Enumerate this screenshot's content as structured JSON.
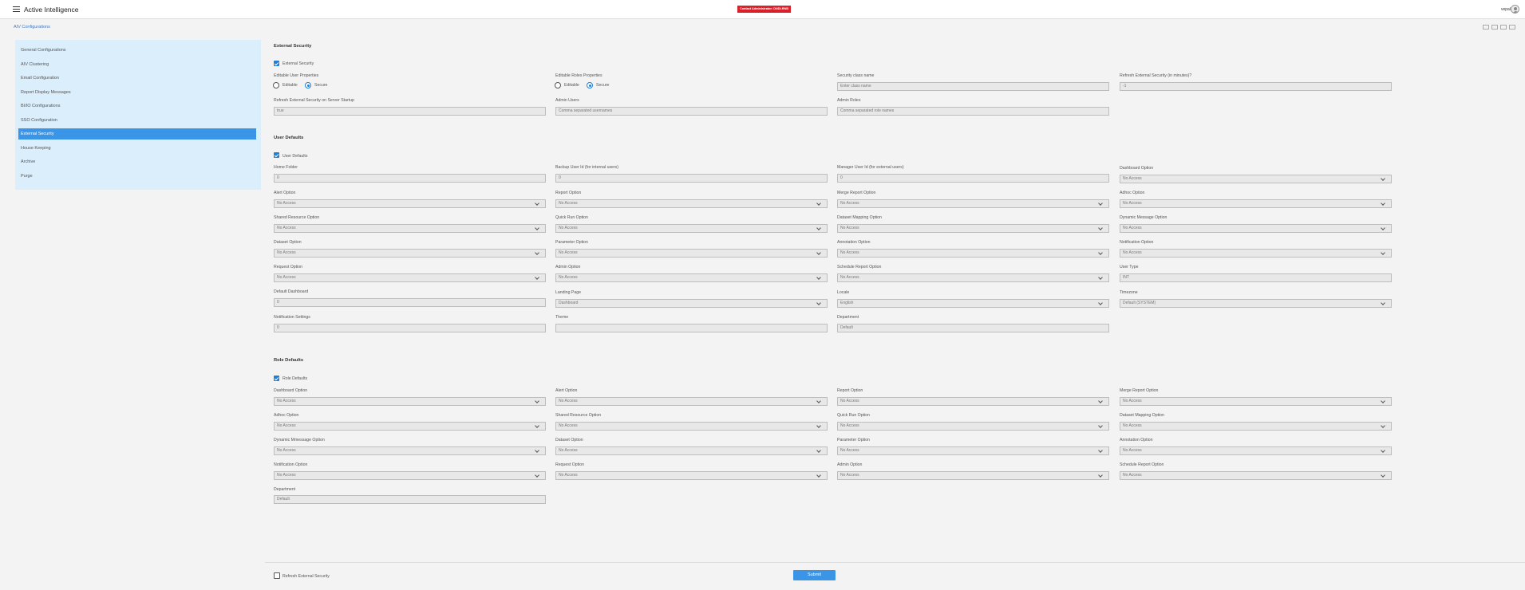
{
  "app": {
    "title": "Active Intelligence",
    "contact_badge": "Contact Administrator: DNDLRNB",
    "user": "vepal"
  },
  "breadcrumb": "AIV Configurations",
  "sidebar": {
    "items": [
      {
        "label": "General Configurations"
      },
      {
        "label": "AIV Clustering"
      },
      {
        "label": "Email Configuration"
      },
      {
        "label": "Report Display Messages"
      },
      {
        "label": "BI/IO Configurations"
      },
      {
        "label": "SSO Configuration"
      },
      {
        "label": "External Security"
      },
      {
        "label": "House Keeping"
      },
      {
        "label": "Archive"
      },
      {
        "label": "Purge"
      }
    ]
  },
  "external_security": {
    "title": "External Security",
    "checkbox": "External Security",
    "editable_user_properties": "Editable User Properties",
    "editable_roles_properties": "Editable Roles Properties",
    "editable": "Editable",
    "secure": "Secure",
    "security_class_name": {
      "label": "Security class name",
      "placeholder": "Enter class name"
    },
    "refresh_minutes": {
      "label": "Refresh External Security (in minutes)?",
      "value": "-1"
    },
    "refresh_startup": {
      "label": "Refresh External Security on Server Startup",
      "value": "true"
    },
    "admin_users": {
      "label": "Admin Users",
      "placeholder": "Comma separated usernames"
    },
    "admin_roles": {
      "label": "Admin Roles",
      "placeholder": "Comma separated role names"
    }
  },
  "user_defaults": {
    "title": "User Defaults",
    "checkbox": "User Defaults",
    "home_folder": {
      "label": "Home Folder",
      "value": "0"
    },
    "backup_user": {
      "label": "Backup User Id (for internal users)",
      "value": "0"
    },
    "manager_user": {
      "label": "Manager User Id (for external users)",
      "value": "0"
    },
    "dashboard_option": {
      "label": "Dashboard Option",
      "value": "No Access"
    },
    "alert_option": {
      "label": "Alert Option",
      "value": "No Access"
    },
    "report_option": {
      "label": "Report Option",
      "value": "No Access"
    },
    "merge_report_option": {
      "label": "Merge Report Option",
      "value": "No Access"
    },
    "adhoc_option": {
      "label": "Adhoc Option",
      "value": "No Access"
    },
    "shared_resource_option": {
      "label": "Shared Resource Option",
      "value": "No Access"
    },
    "quick_run_option": {
      "label": "Quick Run Option",
      "value": "No Access"
    },
    "dataset_mapping_option": {
      "label": "Dataset Mapping Option",
      "value": "No Access"
    },
    "dynamic_message_option": {
      "label": "Dynamic Message Option",
      "value": "No Access"
    },
    "dataset_option": {
      "label": "Dataset Option",
      "value": "No Access"
    },
    "parameter_option": {
      "label": "Parameter Option",
      "value": "No Access"
    },
    "annotation_option": {
      "label": "Annotation Option",
      "value": "No Access"
    },
    "notification_option": {
      "label": "Notification Option",
      "value": "No Access"
    },
    "request_option": {
      "label": "Request Option",
      "value": "No Access"
    },
    "admin_option": {
      "label": "Admin Option",
      "value": "No Access"
    },
    "schedule_report_option": {
      "label": "Schedule Report Option",
      "value": "No Access"
    },
    "user_type": {
      "label": "User Type",
      "value": "INT"
    },
    "default_dashboard": {
      "label": "Default Dashboard",
      "value": "0"
    },
    "landing_page": {
      "label": "Landing Page",
      "value": "Dashboard"
    },
    "locale": {
      "label": "Locale",
      "value": "English"
    },
    "timezone": {
      "label": "Timezone",
      "value": "Default (SYSTEM)"
    },
    "notification_settings": {
      "label": "Notification Settings",
      "value": "0"
    },
    "theme": {
      "label": "Theme",
      "value": ""
    },
    "department": {
      "label": "Department",
      "value": "Default"
    }
  },
  "role_defaults": {
    "title": "Role Defaults",
    "checkbox": "Role Defaults",
    "dashboard_option": {
      "label": "Dashboard Option",
      "value": "No Access"
    },
    "alert_option": {
      "label": "Alert Option",
      "value": "No Access"
    },
    "report_option": {
      "label": "Report Option",
      "value": "No Access"
    },
    "merge_report_option": {
      "label": "Merge Report Option",
      "value": "No Access"
    },
    "adhoc_option": {
      "label": "Adhoc Option",
      "value": "No Access"
    },
    "shared_resource_option": {
      "label": "Shared Resource Option",
      "value": "No Access"
    },
    "quick_run_option": {
      "label": "Quick Run Option",
      "value": "No Access"
    },
    "dataset_mapping_option": {
      "label": "Dataset Mapping Option",
      "value": "No Access"
    },
    "dynamic_message_option": {
      "label": "Dynamic Mmessage Option",
      "value": "No Access"
    },
    "dataset_option": {
      "label": "Dataset Option",
      "value": "No Access"
    },
    "parameter_option": {
      "label": "Parameter Option",
      "value": "No Access"
    },
    "annotation_option": {
      "label": "Annotation Option",
      "value": "No Access"
    },
    "notification_option": {
      "label": "Notification Option",
      "value": "No Access"
    },
    "request_option": {
      "label": "Request Option",
      "value": "No Access"
    },
    "admin_option": {
      "label": "Admin Option",
      "value": "No Access"
    },
    "schedule_report_option": {
      "label": "Schedule Report Option",
      "value": "No Access"
    },
    "department": {
      "label": "Department",
      "value": "Default"
    }
  },
  "footer": {
    "refresh_checkbox": "Refresh External Security",
    "submit": "Submit"
  }
}
